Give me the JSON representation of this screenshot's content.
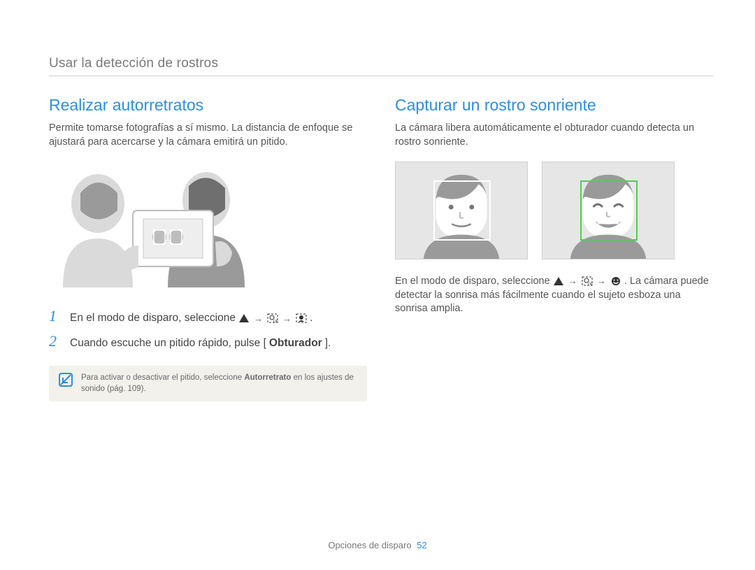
{
  "header": "Usar la detección de rostros",
  "left": {
    "title": "Realizar autorretratos",
    "intro": "Permite tomarse fotografías a sí mismo. La distancia de enfoque se ajustará para acercarse y la cámara emitirá un pitido.",
    "steps": [
      {
        "num": "1",
        "text_before": "En el modo de disparo, seleccione ",
        "text_after": "."
      },
      {
        "num": "2",
        "text_before": "Cuando escuche un pitido rápido, pulse [",
        "bold": "Obturador",
        "text_after": "]."
      }
    ],
    "note_before": "Para activar o desactivar el pitido, seleccione ",
    "note_bold": "Autorretrato",
    "note_after": " en los ajustes de sonido (pág. 109)."
  },
  "right": {
    "title": "Capturar un rostro sonriente",
    "intro": "La cámara libera automáticamente el obturador cuando detecta un rostro sonriente.",
    "para_before": "En el modo de disparo, seleccione ",
    "para_after": ". La cámara puede detectar la sonrisa más fácilmente cuando el sujeto esboza una sonrisa amplia."
  },
  "footer": {
    "section": "Opciones de disparo",
    "page": "52"
  }
}
